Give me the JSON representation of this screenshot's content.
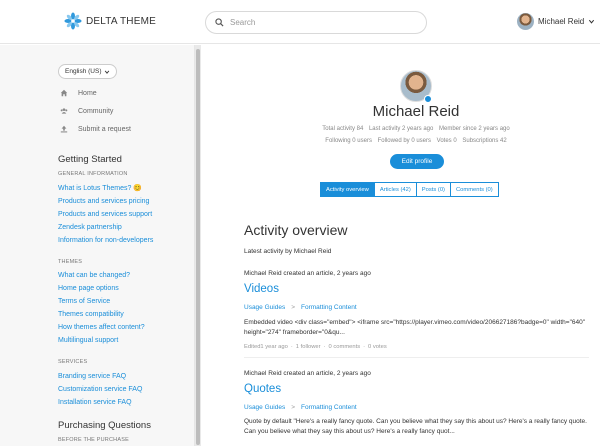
{
  "header": {
    "brand": "DELTA THEME",
    "search_placeholder": "Search",
    "user_name": "Michael Reid",
    "colors": {
      "accent": "#1a8ed9"
    }
  },
  "sidebar": {
    "language": "English (US)",
    "nav": [
      {
        "label": "Home",
        "icon": "home-icon"
      },
      {
        "label": "Community",
        "icon": "community-icon"
      },
      {
        "label": "Submit a request",
        "icon": "upload-icon"
      }
    ],
    "getting_started": {
      "title": "Getting Started",
      "general_information": {
        "label": "GENERAL INFORMATION",
        "links": [
          "What is Lotus Themes? 😊",
          "Products and services pricing",
          "Products and services support",
          "Zendesk partnership",
          "Information for non-developers"
        ]
      },
      "themes": {
        "label": "THEMES",
        "links": [
          "What can be changed?",
          "Home page options",
          "Terms of Service",
          "Themes compatibility",
          "How themes affect content?",
          "Multilingual support"
        ]
      },
      "services": {
        "label": "SERVICES",
        "links": [
          "Branding service FAQ",
          "Customization service FAQ",
          "Installation service FAQ"
        ]
      }
    },
    "purchasing": {
      "title": "Purchasing Questions",
      "before_label": "BEFORE THE PURCHASE"
    }
  },
  "profile": {
    "name": "Michael Reid",
    "stats_row1": [
      "Total activity 84",
      "Last activity 2 years ago",
      "Member since 2 years ago"
    ],
    "stats_row2": [
      "Following 0 users",
      "Followed by 0 users",
      "Votes 0",
      "Subscriptions 42"
    ],
    "edit_label": "Edit profile",
    "tabs": [
      "Activity overview",
      "Articles (42)",
      "Posts (0)",
      "Comments (0)"
    ]
  },
  "activity": {
    "title": "Activity overview",
    "subtitle": "Latest activity by Michael Reid",
    "items": [
      {
        "head": "Michael Reid created an article, 2 years ago",
        "title": "Videos",
        "crumbs": [
          "Usage Guides",
          ">",
          "Formatting Content"
        ],
        "body": "Embedded video <div class=\"embed\"> <iframe src=\"https://player.vimeo.com/video/206627186?badge=0\" width=\"640\" height=\"274\" frameborder=\"0&qu...",
        "meta": [
          "Edited1 year ago",
          "·",
          "1 follower",
          "·",
          "0 comments",
          "·",
          "0 votes"
        ]
      },
      {
        "head": "Michael Reid created an article, 2 years ago",
        "title": "Quotes",
        "crumbs": [
          "Usage Guides",
          ">",
          "Formatting Content"
        ],
        "body": "Quote by default \"Here's a really fancy quote. Can you believe what they say this about us? Here's a really fancy quote. Can you believe what they say this about us? Here's a really fancy quot..."
      }
    ]
  }
}
